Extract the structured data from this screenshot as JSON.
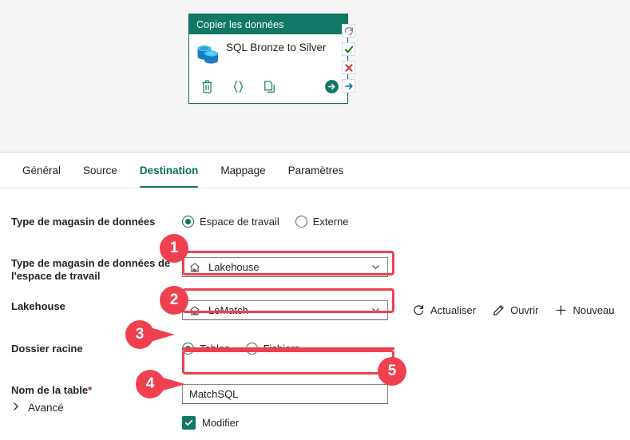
{
  "canvas": {
    "activity_card": {
      "header_title": "Copier les données",
      "name": "SQL Bronze to Silver",
      "icon": "database-icon",
      "actions": [
        {
          "name": "delete-icon",
          "label": "Supprimer"
        },
        {
          "name": "code-braces-icon",
          "label": "Code"
        },
        {
          "name": "duplicate-icon",
          "label": "Dupliquer"
        },
        {
          "name": "run-arrow-icon",
          "label": "Exécuter"
        }
      ]
    },
    "status_chips": [
      {
        "name": "retry-icon",
        "color": "#8a8886"
      },
      {
        "name": "success-check-icon",
        "color": "#107c10"
      },
      {
        "name": "failure-cross-icon",
        "color": "#d13438"
      },
      {
        "name": "completion-arrow-icon",
        "color": "#0f6cbd"
      }
    ]
  },
  "tabs": [
    {
      "label": "Général",
      "active": false
    },
    {
      "label": "Source",
      "active": false
    },
    {
      "label": "Destination",
      "active": true
    },
    {
      "label": "Mappage",
      "active": false
    },
    {
      "label": "Paramètres",
      "active": false
    }
  ],
  "form": {
    "store_type": {
      "label": "Type de magasin de données",
      "options": [
        "Espace de travail",
        "Externe"
      ],
      "selected": "Espace de travail"
    },
    "workspace_store_type": {
      "label": "Type de magasin de données de l'espace de travail",
      "value": "Lakehouse",
      "icon": "lakehouse-icon",
      "chevron": "chevron-down-icon"
    },
    "lakehouse": {
      "label": "Lakehouse",
      "value": "LeMatch",
      "icon": "lakehouse-icon",
      "chevron": "chevron-down-icon",
      "actions": [
        {
          "label": "Actualiser",
          "icon": "refresh-icon"
        },
        {
          "label": "Ouvrir",
          "icon": "pencil-icon"
        },
        {
          "label": "Nouveau",
          "icon": "plus-icon"
        }
      ]
    },
    "root_folder": {
      "label": "Dossier racine",
      "options": [
        "Tables",
        "Fichiers"
      ],
      "selected": "Tables"
    },
    "table_name": {
      "label": "Nom de la table",
      "required_marker": "*",
      "value": "MatchSQL",
      "placeholder": "Nom de la table"
    },
    "edit_checkbox": {
      "label": "Modifier",
      "checked": true
    },
    "advanced": {
      "label": "Avancé",
      "icon": "chevron-right-icon",
      "expanded": false
    }
  },
  "annotations": {
    "accent_color": "#ef4050",
    "badges": [
      {
        "number": "1",
        "target": "workspace-store-type-dropdown"
      },
      {
        "number": "2",
        "target": "lakehouse-dropdown"
      },
      {
        "number": "3",
        "target": "root-folder-tables-radio"
      },
      {
        "number": "4",
        "target": "edit-checkbox"
      },
      {
        "number": "5",
        "target": "table-name-input"
      }
    ]
  },
  "theme": {
    "brand_teal": "#117865",
    "card_header": "#117865",
    "canvas_bg": "#f5f5f5"
  }
}
